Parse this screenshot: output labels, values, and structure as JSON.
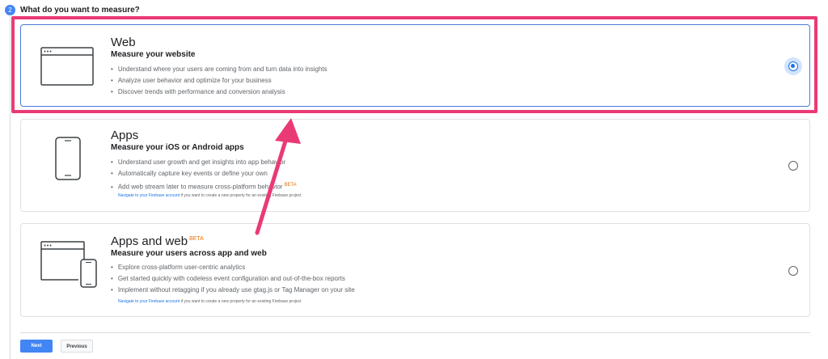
{
  "step": {
    "number": "2",
    "title": "What do you want to measure?"
  },
  "options": [
    {
      "name": "Web",
      "subtitle": "Measure your website",
      "bullets": [
        "Understand where your users are coming from and turn data into insights",
        "Analyze user behavior and optimize for your business",
        "Discover trends with performance and conversion analysis"
      ],
      "selected": true
    },
    {
      "name": "Apps",
      "subtitle": "Measure your iOS or Android apps",
      "bullets": [
        "Understand user growth and get insights into app behavior",
        "Automatically capture key events or define your own",
        "Add web stream later to measure cross-platform behavior"
      ],
      "beta": "BETA",
      "note_link": "Navigate to your Firebase account",
      "note_text": " if you want to create a new property for an existing Firebase project",
      "selected": false
    },
    {
      "name": "Apps and web",
      "name_beta": "BETA",
      "subtitle": "Measure your users across app and web",
      "bullets": [
        "Explore cross-platform user-centric analytics",
        "Get started quickly with codeless event configuration and out-of-the-box reports",
        "Implement without retagging if you already use gtag.js or Tag Manager on your site"
      ],
      "note_link": "Navigate to your Firebase account",
      "note_text": " if you want to create a new property for an existing Firebase project",
      "selected": false
    }
  ],
  "buttons": {
    "next": "Next",
    "previous": "Previous"
  },
  "colors": {
    "accent": "#1a73e8",
    "highlight": "#ea3a76",
    "beta": "#e8710a"
  }
}
